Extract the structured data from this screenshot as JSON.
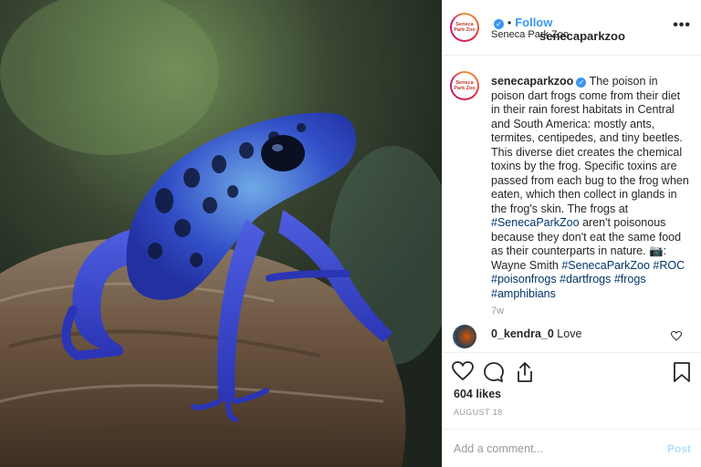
{
  "account": {
    "username": "senecaparkzoo",
    "location": "Seneca Park Zoo",
    "follow_label": "Follow",
    "avatar_text": "Seneca Park Zoo"
  },
  "caption": {
    "username": "senecaparkzoo",
    "text_1": "The poison in poison dart frogs come from their diet in their rain forest habitats in Central and South America: mostly ants, termites, centipedes, and tiny beetles. This diverse diet creates the chemical toxins by the frog. Specific toxins are passed from each bug to the frog when eaten, which then collect in glands in the frog's skin. The frogs at ",
    "tag_1": "#SenecaParkZoo",
    "text_2": " aren't poisonous because they don't eat the same food as their counterparts in nature. 📷: Wayne Smith ",
    "tag_2": "#SenecaParkZoo",
    "tag_3": "#ROC",
    "tag_4": "#poisonfrogs",
    "tag_5": "#dartfrogs",
    "tag_6": "#frogs",
    "tag_7": "#amphibians",
    "time": "7w"
  },
  "comment": {
    "username": "0_kendra_0",
    "text": "Love"
  },
  "stats": {
    "likes": "604 likes",
    "date": "AUGUST 18"
  },
  "add_comment": {
    "placeholder": "Add a comment...",
    "post_label": "Post"
  },
  "icons": {
    "more": "more-options-icon",
    "verified": "verified-badge-icon",
    "like": "heart-icon",
    "comment": "comment-icon",
    "share": "share-icon",
    "save": "bookmark-icon"
  },
  "colors": {
    "accent": "#3897f0",
    "hashtag": "#003569",
    "post_disabled": "#b2dffc",
    "frog_blue": "#3b4fd0"
  }
}
